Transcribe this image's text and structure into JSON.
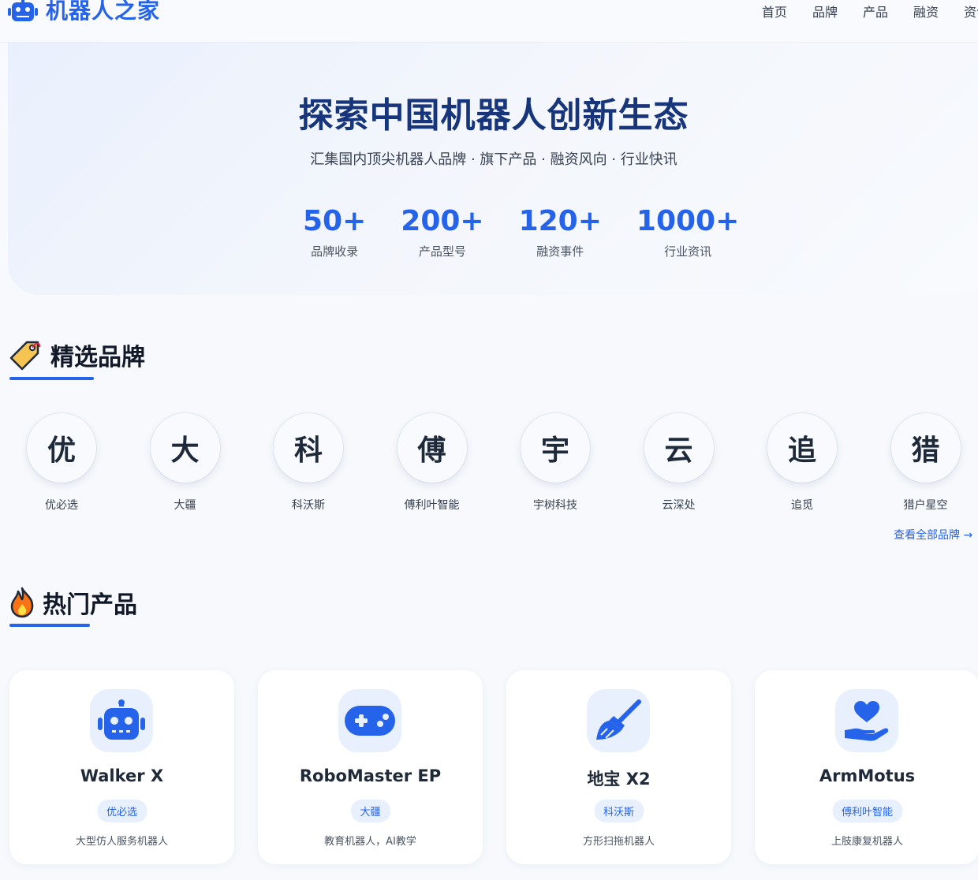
{
  "header": {
    "logo_text": "机器人之家",
    "nav": [
      "首页",
      "品牌",
      "产品",
      "融资",
      "资讯"
    ]
  },
  "hero": {
    "title": "探索中国机器人创新生态",
    "subtitle": "汇集国内顶尖机器人品牌 · 旗下产品 · 融资风向 · 行业快讯",
    "stats": [
      {
        "value": "50+",
        "label": "品牌收录"
      },
      {
        "value": "200+",
        "label": "产品型号"
      },
      {
        "value": "120+",
        "label": "融资事件"
      },
      {
        "value": "1000+",
        "label": "行业资讯"
      }
    ]
  },
  "brands_section": {
    "title": "精选品牌",
    "view_all": "查看全部品牌 →",
    "items": [
      {
        "initial": "优",
        "name": "优必选"
      },
      {
        "initial": "大",
        "name": "大疆"
      },
      {
        "initial": "科",
        "name": "科沃斯"
      },
      {
        "initial": "傅",
        "name": "傅利叶智能"
      },
      {
        "initial": "宇",
        "name": "宇树科技"
      },
      {
        "initial": "云",
        "name": "云深处"
      },
      {
        "initial": "追",
        "name": "追觅"
      },
      {
        "initial": "猎",
        "name": "猎户星空"
      }
    ]
  },
  "products_section": {
    "title": "热门产品",
    "items": [
      {
        "icon": "robot-icon",
        "name": "Walker X",
        "brand": "优必选",
        "desc": "大型仿人服务机器人"
      },
      {
        "icon": "gamepad-icon",
        "name": "RoboMaster EP",
        "brand": "大疆",
        "desc": "教育机器人，AI教学"
      },
      {
        "icon": "broom-icon",
        "name": "地宝 X2",
        "brand": "科沃斯",
        "desc": "方形扫拖机器人"
      },
      {
        "icon": "heart-hand-icon",
        "name": "ArmMotus",
        "brand": "傅利叶智能",
        "desc": "上肢康复机器人"
      }
    ]
  },
  "colors": {
    "accent": "#2563eb",
    "title_dark": "#17357a",
    "chip_bg": "#e8f0fe"
  }
}
